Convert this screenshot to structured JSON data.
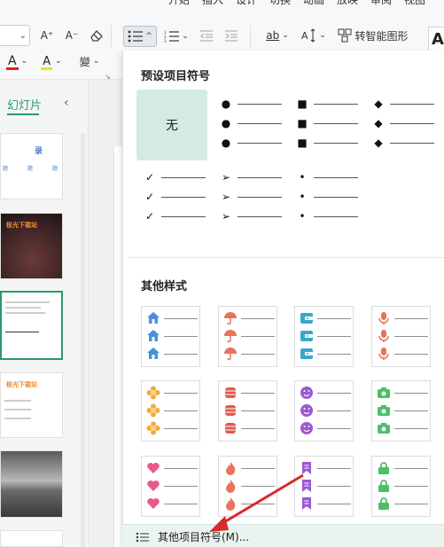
{
  "ribbon_tabs": [
    "开始",
    "插入",
    "设计",
    "切换",
    "动画",
    "放映",
    "审阅",
    "视图"
  ],
  "toolbar": {
    "font_size_value": "",
    "increase_font_label": "A⁺",
    "decrease_font_label": "A⁻",
    "font_color_label": "A",
    "highlight_label": "A",
    "phonetic_label": "變",
    "convert_smartart_label": "转智能图形",
    "right_edge_label": "A"
  },
  "left_pane": {
    "tab_label": "幻灯片",
    "collapse_icon": "chevron-left-icon",
    "slides": [
      {
        "title": "录",
        "subtitle_items": [
          "题",
          "题",
          "题"
        ]
      },
      {
        "title": "极光下载站",
        "subtitle_items": []
      },
      {
        "title": "",
        "subtitle_items": []
      },
      {
        "title": "极光下载站",
        "subtitle_items": []
      },
      {
        "title": "",
        "subtitle_items": []
      },
      {
        "title": "",
        "subtitle_items": []
      }
    ]
  },
  "bullet_panel": {
    "preset_header": "预设项目符号",
    "none_label": "无",
    "presets": [
      {
        "marker": "●"
      },
      {
        "marker": "■"
      },
      {
        "marker": "◆"
      },
      {
        "marker": "✓"
      },
      {
        "marker": "➢"
      },
      {
        "marker": "•"
      }
    ],
    "other_header": "其他样式",
    "other_styles": [
      {
        "icon": "home-icon",
        "color": "#4a90d9"
      },
      {
        "icon": "umbrella-icon",
        "color": "#e8735a"
      },
      {
        "icon": "wallet-icon",
        "color": "#3aa8c9"
      },
      {
        "icon": "microphone-icon",
        "color": "#e8735a"
      },
      {
        "icon": "flower-icon",
        "color": "#f2a93b"
      },
      {
        "icon": "cylinder-icon",
        "color": "#e25a4f"
      },
      {
        "icon": "smiley-icon",
        "color": "#9b59d0"
      },
      {
        "icon": "camera-icon",
        "color": "#4bbf6b"
      },
      {
        "icon": "heart-icon",
        "color": "#e85a8a"
      },
      {
        "icon": "flame-icon",
        "color": "#e8735a"
      },
      {
        "icon": "bookmark-icon",
        "color": "#9b59d0"
      },
      {
        "icon": "lock-icon",
        "color": "#4bbf6b"
      }
    ],
    "footer_label": "其他项目符号(M)..."
  },
  "accent_color": "#2b9a67",
  "annotation_arrow_color": "#d62b2b"
}
